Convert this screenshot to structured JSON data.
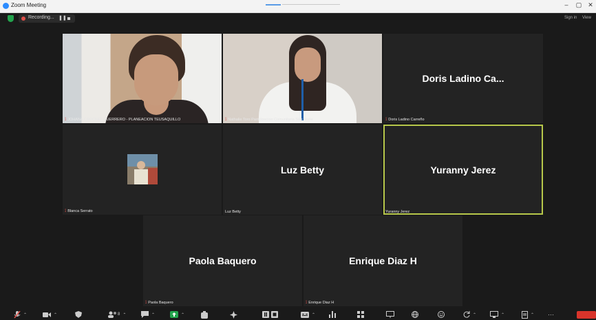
{
  "window": {
    "title": "Zoom Meeting"
  },
  "topbar": {
    "recording_label": "Recording...",
    "sign_in": "Sign in",
    "view": "View"
  },
  "tiles": {
    "t1": {
      "label": "JOHANA CROCKEZ GUERRERO - PLANEACION TEUSAQUILLO"
    },
    "t2": {
      "label": "Nathalie Toro Participacion Comunitaria Siss Norte"
    },
    "t3": {
      "name": "Doris Ladino Ca...",
      "label": "Doris Ladino Carreño"
    },
    "t4": {
      "label": "Blanca Serrato"
    },
    "t5": {
      "name": "Luz Betty",
      "label": "Luz Betty"
    },
    "t6": {
      "name": "Yuranny Jerez",
      "label": "Yuranny Jerez"
    },
    "t7": {
      "name": "Paola Baquero",
      "label": "Paola Baquero"
    },
    "t8": {
      "name": "Enrique Diaz H",
      "label": "Enrique Diaz H"
    }
  },
  "toolbar": {
    "participants_count": "8",
    "more": "···"
  },
  "colors": {
    "accent": "#2d8cff",
    "active_speaker": "#b7c84a",
    "muted": "#e0504a",
    "end": "#d9342b"
  }
}
